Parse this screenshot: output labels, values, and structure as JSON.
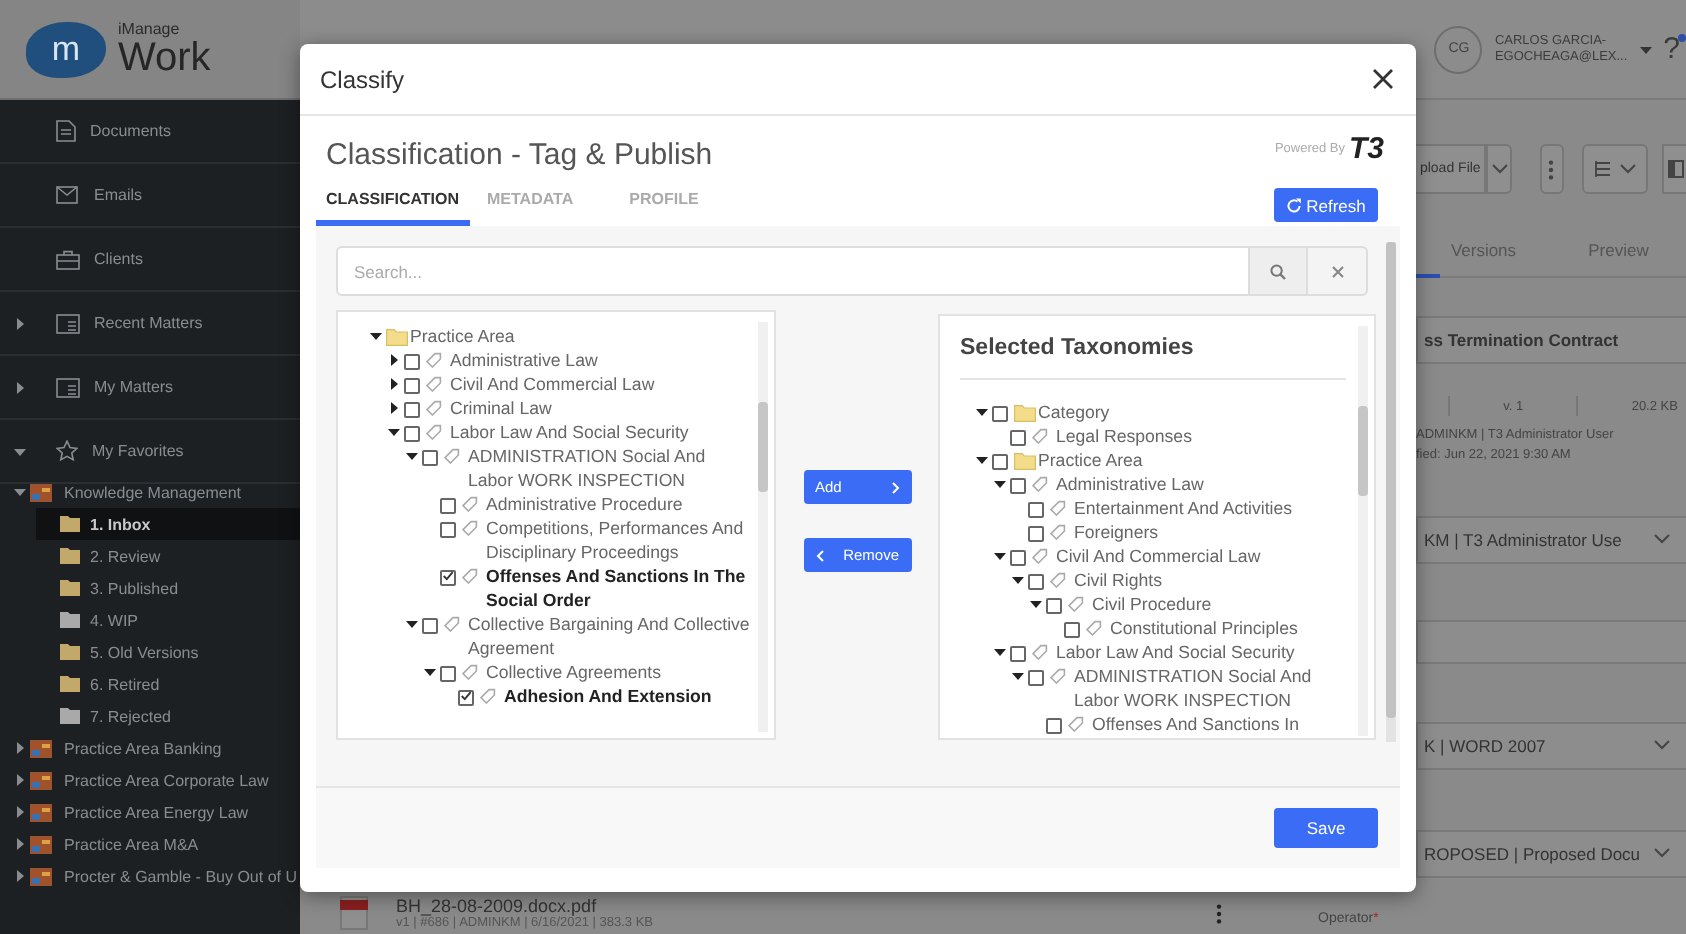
{
  "sidebar": {
    "logo": {
      "mark": "m",
      "name_top": "iManage",
      "name_bottom": "Work"
    },
    "nav": [
      {
        "label": "Documents"
      },
      {
        "label": "Emails"
      },
      {
        "label": "Clients"
      },
      {
        "label": "Recent Matters",
        "expanded": false
      },
      {
        "label": "My Matters",
        "expanded": false
      },
      {
        "label": "My Favorites",
        "expanded": true
      }
    ],
    "favorites": [
      {
        "label": "Knowledge Management",
        "expanded": true,
        "children": [
          {
            "label": "1. Inbox",
            "selected": true,
            "color": "#c2a96b"
          },
          {
            "label": "2. Review",
            "selected": false,
            "color": "#c2a96b"
          },
          {
            "label": "3. Published",
            "selected": false,
            "color": "#c2a96b"
          },
          {
            "label": "4. WIP",
            "selected": false,
            "color": "#a9a9a9"
          },
          {
            "label": "5. Old Versions",
            "selected": false,
            "color": "#c2a96b"
          },
          {
            "label": "6. Retired",
            "selected": false,
            "color": "#c2a96b"
          },
          {
            "label": "7. Rejected",
            "selected": false,
            "color": "#a9a9a9"
          }
        ]
      },
      {
        "label": "Practice Area Banking",
        "expanded": false
      },
      {
        "label": "Practice Area Corporate Law",
        "expanded": false
      },
      {
        "label": "Practice Area Energy Law",
        "expanded": false
      },
      {
        "label": "Practice Area M&A",
        "expanded": false
      },
      {
        "label": "Procter & Gamble - Buy Out of U",
        "expanded": false
      }
    ]
  },
  "header": {
    "avatar": "CG",
    "user_lines": [
      "CARLOS GARCIA-",
      "EGOCHEAGA@LEX..."
    ],
    "help": "?"
  },
  "details": {
    "upload_button": "pload File",
    "tabs": [
      {
        "label": "Versions",
        "selected": false
      },
      {
        "label": "Preview",
        "selected": false
      }
    ],
    "title": "ss Termination Contract",
    "version": "v. 1",
    "size": "20.2 KB",
    "author": "ADMINKM | T3 Administrator User",
    "modified": "fied: Jun 22, 2021 9:30 AM",
    "fields": [
      {
        "kind": "select",
        "value": "KM | T3 Administrator Use"
      },
      {
        "kind": "text"
      },
      {
        "kind": "select",
        "value": "K | WORD 2007"
      },
      {
        "kind": "select",
        "value": "ROPOSED | Proposed Docu"
      }
    ],
    "operator_label": "Operator",
    "required_mark": "*"
  },
  "file_row": {
    "name": "BH_28-08-2009.docx.pdf",
    "meta": "v1 | #686 | ADMINKM | 6/16/2021 | 383.3 KB"
  },
  "dialog": {
    "title": "Classify",
    "heading": "Classification - Tag & Publish",
    "powered_by": "Powered By",
    "brand": "T3",
    "tabs": [
      {
        "label": "CLASSIFICATION",
        "selected": true
      },
      {
        "label": "METADATA",
        "selected": false
      },
      {
        "label": "PROFILE",
        "selected": false
      }
    ],
    "refresh": "Refresh",
    "search": {
      "placeholder": "Search..."
    },
    "available_tree": [
      {
        "label": "Practice Area",
        "kind": "folder",
        "expanded": true,
        "children": [
          {
            "label": "Administrative Law",
            "kind": "tag",
            "expanded": false,
            "checked": false
          },
          {
            "label": "Civil And Commercial Law",
            "kind": "tag",
            "expanded": false,
            "checked": false
          },
          {
            "label": "Criminal Law",
            "kind": "tag",
            "expanded": false,
            "checked": false
          },
          {
            "label": "Labor Law And Social Security",
            "kind": "tag",
            "expanded": true,
            "checked": false,
            "children": [
              {
                "label": "ADMINISTRATION Social And Labor WORK INSPECTION",
                "kind": "tag",
                "expanded": true,
                "checked": false,
                "children": [
                  {
                    "label": "Administrative Procedure",
                    "kind": "tag",
                    "checked": false
                  },
                  {
                    "label": "Competitions, Performances And Disciplinary Proceedings",
                    "kind": "tag",
                    "checked": false
                  },
                  {
                    "label": "Offenses And Sanctions In The Social Order",
                    "kind": "tag",
                    "checked": true
                  }
                ]
              },
              {
                "label": "Collective Bargaining And Collective Agreement",
                "kind": "tag",
                "expanded": true,
                "checked": false,
                "children": [
                  {
                    "label": "Collective Agreements",
                    "kind": "tag",
                    "expanded": true,
                    "checked": false,
                    "children": [
                      {
                        "label": "Adhesion And Extension",
                        "kind": "tag",
                        "checked": true
                      }
                    ]
                  }
                ]
              }
            ]
          }
        ]
      }
    ],
    "add": "Add",
    "remove": "Remove",
    "selected_title": "Selected Taxonomies",
    "selected_tree": [
      {
        "label": "Category",
        "kind": "folder",
        "expanded": true,
        "checked": false,
        "children": [
          {
            "label": "Legal Responses",
            "kind": "tag",
            "checked": false
          }
        ]
      },
      {
        "label": "Practice Area",
        "kind": "folder",
        "expanded": true,
        "checked": false,
        "children": [
          {
            "label": "Administrative Law",
            "kind": "tag",
            "expanded": true,
            "checked": false,
            "children": [
              {
                "label": "Entertainment And Activities",
                "kind": "tag",
                "checked": false
              },
              {
                "label": "Foreigners",
                "kind": "tag",
                "checked": false
              }
            ]
          },
          {
            "label": "Civil And Commercial Law",
            "kind": "tag",
            "expanded": true,
            "checked": false,
            "children": [
              {
                "label": "Civil Rights",
                "kind": "tag",
                "expanded": true,
                "checked": false,
                "children": [
                  {
                    "label": "Civil Procedure",
                    "kind": "tag",
                    "expanded": true,
                    "checked": false,
                    "children": [
                      {
                        "label": "Constitutional Principles",
                        "kind": "tag",
                        "checked": false
                      }
                    ]
                  }
                ]
              }
            ]
          },
          {
            "label": "Labor Law And Social Security",
            "kind": "tag",
            "expanded": true,
            "checked": false,
            "children": [
              {
                "label": "ADMINISTRATION Social And Labor WORK INSPECTION",
                "kind": "tag",
                "expanded": true,
                "checked": false,
                "children": [
                  {
                    "label": "Offenses And Sanctions In",
                    "kind": "tag",
                    "checked": false
                  }
                ]
              }
            ]
          }
        ]
      }
    ],
    "save": "Save"
  }
}
